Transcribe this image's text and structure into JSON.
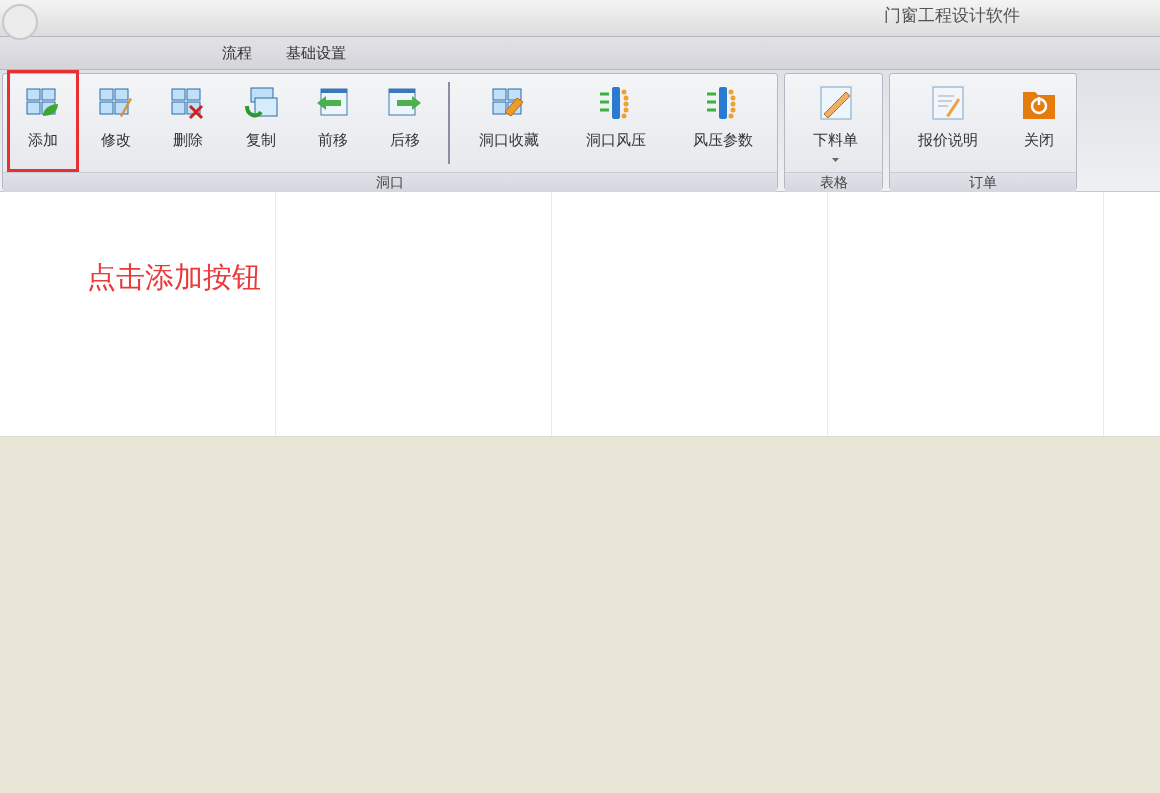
{
  "window": {
    "title": "门窗工程设计软件"
  },
  "menu_tabs": [
    {
      "label": "流程"
    },
    {
      "label": "基础设置"
    }
  ],
  "ribbon_groups": [
    {
      "label": "洞口",
      "buttons": [
        {
          "label": "添加",
          "kind": "add",
          "highlighted": true
        },
        {
          "label": "修改",
          "kind": "edit",
          "highlighted": false
        },
        {
          "label": "删除",
          "kind": "delete",
          "highlighted": false
        },
        {
          "label": "复制",
          "kind": "copy",
          "highlighted": false
        },
        {
          "label": "前移",
          "kind": "left",
          "highlighted": false
        },
        {
          "label": "后移",
          "kind": "right",
          "highlighted": false
        },
        {
          "label": "洞口收藏",
          "kind": "favorite",
          "highlighted": false,
          "separator_before": true
        },
        {
          "label": "洞口风压",
          "kind": "wind",
          "highlighted": false
        },
        {
          "label": "风压参数",
          "kind": "wind",
          "highlighted": false
        }
      ]
    },
    {
      "label": "表格",
      "buttons": [
        {
          "label": "下料单",
          "kind": "ruler",
          "highlighted": false,
          "dropdown": true
        }
      ]
    },
    {
      "label": "订单",
      "buttons": [
        {
          "label": "报价说明",
          "kind": "document",
          "highlighted": false
        },
        {
          "label": "关闭",
          "kind": "power",
          "highlighted": false
        }
      ]
    }
  ],
  "annotation": "点击添加按钮"
}
